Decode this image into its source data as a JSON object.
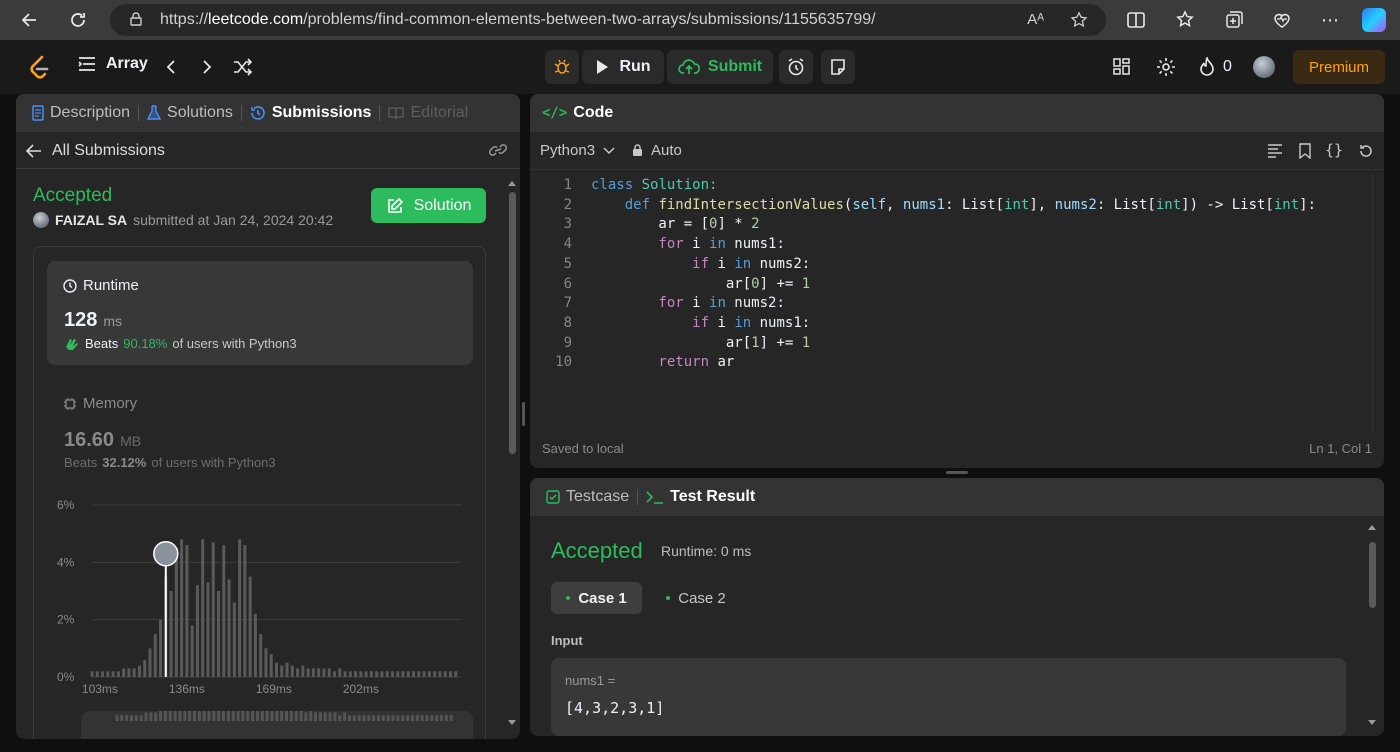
{
  "browser": {
    "url_prefix": "https://",
    "url_host": "leetcode.com",
    "url_path": "/problems/find-common-elements-between-two-arrays/submissions/1155635799/",
    "read_aloud": "Aᴬ"
  },
  "nav": {
    "list_label": "Array",
    "run_label": "Run",
    "submit_label": "Submit",
    "streak_count": "0",
    "premium_label": "Premium"
  },
  "left_tabs": {
    "description": "Description",
    "solutions": "Solutions",
    "submissions": "Submissions",
    "editorial": "Editorial"
  },
  "submission": {
    "back_label": "All Submissions",
    "status": "Accepted",
    "user": "FAIZAL SA",
    "submitted_text": "submitted at Jan 24, 2024 20:42",
    "solution_button": "Solution",
    "runtime_title": "Runtime",
    "runtime_value": "128",
    "runtime_unit": "ms",
    "runtime_beats_prefix": "Beats",
    "runtime_beats": "90.18%",
    "runtime_beats_suffix": "of users with Python3",
    "memory_title": "Memory",
    "memory_value": "16.60",
    "memory_unit": "MB",
    "memory_beats_prefix": "Beats",
    "memory_beats": "32.12%",
    "memory_beats_suffix": "of users with Python3"
  },
  "chart_data": {
    "type": "bar",
    "y_ticks": [
      "6%",
      "4%",
      "2%",
      "0%"
    ],
    "x_ticks": [
      "103ms",
      "136ms",
      "169ms",
      "202ms"
    ],
    "ylim": [
      0,
      6
    ],
    "xlim": [
      100,
      240
    ],
    "user_runtime_ms": 128,
    "user_marker_pct": 4.3,
    "bars": [
      {
        "x": 100,
        "y": 0.2
      },
      {
        "x": 102,
        "y": 0.2
      },
      {
        "x": 104,
        "y": 0.2
      },
      {
        "x": 106,
        "y": 0.2
      },
      {
        "x": 108,
        "y": 0.2
      },
      {
        "x": 110,
        "y": 0.2
      },
      {
        "x": 112,
        "y": 0.3
      },
      {
        "x": 114,
        "y": 0.3
      },
      {
        "x": 116,
        "y": 0.3
      },
      {
        "x": 118,
        "y": 0.4
      },
      {
        "x": 120,
        "y": 0.6
      },
      {
        "x": 122,
        "y": 1.0
      },
      {
        "x": 124,
        "y": 1.5
      },
      {
        "x": 126,
        "y": 2.0
      },
      {
        "x": 128,
        "y": 3.5
      },
      {
        "x": 130,
        "y": 3.0
      },
      {
        "x": 132,
        "y": 4.5
      },
      {
        "x": 134,
        "y": 4.8
      },
      {
        "x": 136,
        "y": 4.6
      },
      {
        "x": 138,
        "y": 1.8
      },
      {
        "x": 140,
        "y": 3.2
      },
      {
        "x": 142,
        "y": 4.8
      },
      {
        "x": 144,
        "y": 3.3
      },
      {
        "x": 146,
        "y": 4.7
      },
      {
        "x": 148,
        "y": 3.0
      },
      {
        "x": 150,
        "y": 4.6
      },
      {
        "x": 152,
        "y": 3.4
      },
      {
        "x": 154,
        "y": 2.6
      },
      {
        "x": 156,
        "y": 4.8
      },
      {
        "x": 158,
        "y": 4.6
      },
      {
        "x": 160,
        "y": 3.5
      },
      {
        "x": 162,
        "y": 2.2
      },
      {
        "x": 164,
        "y": 1.5
      },
      {
        "x": 166,
        "y": 1.0
      },
      {
        "x": 168,
        "y": 0.8
      },
      {
        "x": 170,
        "y": 0.5
      },
      {
        "x": 172,
        "y": 0.4
      },
      {
        "x": 174,
        "y": 0.5
      },
      {
        "x": 176,
        "y": 0.4
      },
      {
        "x": 178,
        "y": 0.3
      },
      {
        "x": 180,
        "y": 0.4
      },
      {
        "x": 182,
        "y": 0.3
      },
      {
        "x": 184,
        "y": 0.3
      },
      {
        "x": 186,
        "y": 0.3
      },
      {
        "x": 188,
        "y": 0.3
      },
      {
        "x": 190,
        "y": 0.3
      },
      {
        "x": 192,
        "y": 0.2
      },
      {
        "x": 194,
        "y": 0.3
      },
      {
        "x": 196,
        "y": 0.2
      },
      {
        "x": 198,
        "y": 0.2
      },
      {
        "x": 200,
        "y": 0.2
      },
      {
        "x": 202,
        "y": 0.2
      },
      {
        "x": 204,
        "y": 0.2
      },
      {
        "x": 206,
        "y": 0.2
      },
      {
        "x": 208,
        "y": 0.2
      },
      {
        "x": 210,
        "y": 0.2
      },
      {
        "x": 212,
        "y": 0.2
      },
      {
        "x": 214,
        "y": 0.2
      },
      {
        "x": 216,
        "y": 0.2
      },
      {
        "x": 218,
        "y": 0.2
      },
      {
        "x": 220,
        "y": 0.2
      },
      {
        "x": 222,
        "y": 0.2
      },
      {
        "x": 224,
        "y": 0.2
      },
      {
        "x": 226,
        "y": 0.2
      },
      {
        "x": 228,
        "y": 0.2
      },
      {
        "x": 230,
        "y": 0.2
      },
      {
        "x": 232,
        "y": 0.2
      },
      {
        "x": 234,
        "y": 0.2
      },
      {
        "x": 236,
        "y": 0.2
      },
      {
        "x": 238,
        "y": 0.2
      }
    ]
  },
  "code_panel": {
    "title": "Code",
    "language": "Python3",
    "mode": "Auto",
    "saved": "Saved to local",
    "cursor": "Ln 1, Col 1"
  },
  "code_lines": [
    {
      "n": "1",
      "tokens": [
        {
          "t": "class",
          "c": "kw2"
        },
        {
          "t": " Solution:",
          "c": "ty"
        }
      ]
    },
    {
      "n": "2",
      "tokens": [
        {
          "t": "    def",
          "c": "kw2"
        },
        {
          "t": " findIntersectionValues",
          "c": "fn"
        },
        {
          "t": "(",
          "c": ""
        },
        {
          "t": "self",
          "c": "pa"
        },
        {
          "t": ", ",
          "c": ""
        },
        {
          "t": "nums1",
          "c": "pa"
        },
        {
          "t": ": List[",
          "c": ""
        },
        {
          "t": "int",
          "c": "ty"
        },
        {
          "t": "], ",
          "c": ""
        },
        {
          "t": "nums2",
          "c": "pa"
        },
        {
          "t": ": List[",
          "c": ""
        },
        {
          "t": "int",
          "c": "ty"
        },
        {
          "t": "]) -> List[",
          "c": ""
        },
        {
          "t": "int",
          "c": "ty"
        },
        {
          "t": "]:",
          "c": ""
        }
      ]
    },
    {
      "n": "3",
      "tokens": [
        {
          "t": "        ar = [",
          "c": ""
        },
        {
          "t": "0",
          "c": "nm"
        },
        {
          "t": "] * ",
          "c": ""
        },
        {
          "t": "2",
          "c": "nm"
        }
      ]
    },
    {
      "n": "4",
      "tokens": [
        {
          "t": "        for",
          "c": "kw"
        },
        {
          "t": " i ",
          "c": ""
        },
        {
          "t": "in",
          "c": "kw2"
        },
        {
          "t": " nums1:",
          "c": ""
        }
      ]
    },
    {
      "n": "5",
      "tokens": [
        {
          "t": "            if",
          "c": "kw"
        },
        {
          "t": " i ",
          "c": ""
        },
        {
          "t": "in",
          "c": "kw2"
        },
        {
          "t": " nums2:",
          "c": ""
        }
      ]
    },
    {
      "n": "6",
      "tokens": [
        {
          "t": "                ar[",
          "c": ""
        },
        {
          "t": "0",
          "c": "nm"
        },
        {
          "t": "] += ",
          "c": ""
        },
        {
          "t": "1",
          "c": "nm"
        }
      ]
    },
    {
      "n": "7",
      "tokens": [
        {
          "t": "        for",
          "c": "kw"
        },
        {
          "t": " i ",
          "c": ""
        },
        {
          "t": "in",
          "c": "kw2"
        },
        {
          "t": " nums2:",
          "c": ""
        }
      ]
    },
    {
      "n": "8",
      "tokens": [
        {
          "t": "            if",
          "c": "kw"
        },
        {
          "t": " i ",
          "c": ""
        },
        {
          "t": "in",
          "c": "kw2"
        },
        {
          "t": " nums1:",
          "c": ""
        }
      ]
    },
    {
      "n": "9",
      "tokens": [
        {
          "t": "                ar[",
          "c": ""
        },
        {
          "t": "1",
          "c": "nm"
        },
        {
          "t": "] += ",
          "c": ""
        },
        {
          "t": "1",
          "c": "nm"
        }
      ]
    },
    {
      "n": "10",
      "tokens": [
        {
          "t": "        return",
          "c": "kw"
        },
        {
          "t": " ar",
          "c": ""
        }
      ]
    }
  ],
  "test_panel": {
    "testcase_tab": "Testcase",
    "result_tab": "Test Result",
    "status": "Accepted",
    "runtime": "Runtime: 0 ms",
    "case1": "Case 1",
    "case2": "Case 2",
    "input_label": "Input",
    "var_name": "nums1 =",
    "var_value": "[4,3,2,3,1]"
  }
}
